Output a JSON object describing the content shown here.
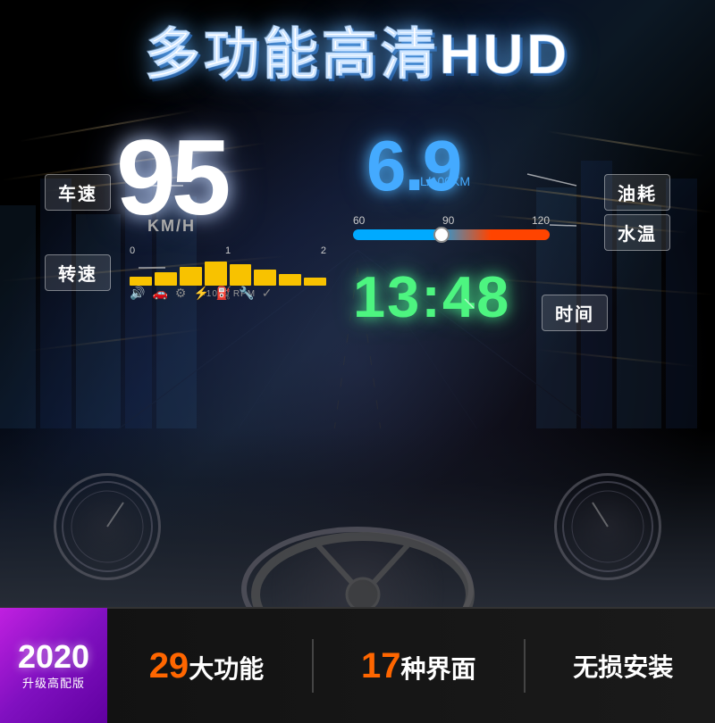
{
  "title": "多功能高清HUD",
  "hud": {
    "speed": "95",
    "speed_unit": "KM/H",
    "fuel": "6.9",
    "fuel_unit": "L/100KM",
    "time": "13:48",
    "temp_marks": [
      "60",
      "90",
      "120"
    ],
    "rpm_label": "×1000 RPM"
  },
  "labels": {
    "speed": "车速",
    "rpm": "转速",
    "fuel": "油耗",
    "temp": "水温",
    "time": "时间"
  },
  "bottom": {
    "year": "2020",
    "badge_sub": "升级高配版",
    "feature1_num": "29",
    "feature1_text": "大功能",
    "feature2_num": "17",
    "feature2_text": "种界面",
    "feature3_text": "无损安装"
  }
}
